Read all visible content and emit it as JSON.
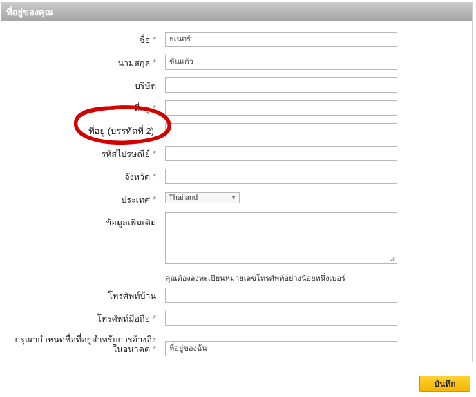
{
  "header": {
    "title": "ที่อยู่ของคุณ"
  },
  "form": {
    "required_mark": "*",
    "first_name": {
      "label": "ชื่อ",
      "value": "ธเนตร์"
    },
    "last_name": {
      "label": "นามสกุล",
      "value": "ขันแก้ว"
    },
    "company": {
      "label": "บริษัท",
      "value": ""
    },
    "address1": {
      "label": "ที่อยู่",
      "value": ""
    },
    "address2": {
      "label": "ที่อยู่ (บรรทัดที่ 2)",
      "value": ""
    },
    "postcode": {
      "label": "รหัสไปรษณีย์",
      "value": ""
    },
    "province": {
      "label": "จังหวัด",
      "value": ""
    },
    "country": {
      "label": "ประเทศ",
      "value": "Thailand"
    },
    "additional_info": {
      "label": "ข้อมูลเพิ่มเติม",
      "value": ""
    },
    "phone_note": "คุณต้องลงทะเบียนหมายเลขโทรศัพท์อย่างน้อยหนึ่งเบอร์",
    "home_phone": {
      "label": "โทรศัพท์บ้าน",
      "value": ""
    },
    "mobile_phone": {
      "label": "โทรศัพท์มือถือ",
      "value": ""
    },
    "alias": {
      "label_line1": "กรุณากำหนดชื่อที่อยู่สำหรับการอ้างอิง",
      "label_line2": "ในอนาคต",
      "value": "ที่อยู่ของฉัน"
    }
  },
  "save_button": {
    "label": "บันทึก"
  },
  "annotation": {
    "color": "#d40000",
    "shape": "hand-drawn-circle"
  }
}
